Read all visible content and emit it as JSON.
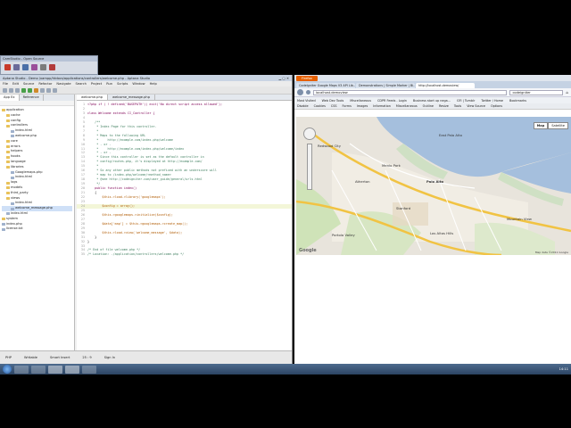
{
  "cam_window": {
    "title": "CamStudio - Open Source"
  },
  "ide": {
    "title": "Aptana Studio - Demo /xampp/htdocs/applications/controllers/welcome.php - Aptana Studio",
    "menu": [
      "File",
      "Edit",
      "Source",
      "Refactor",
      "Navigate",
      "Search",
      "Project",
      "Run",
      "Scripts",
      "Window",
      "Help"
    ],
    "explorer_tabs": [
      "App Ex",
      "Reference"
    ],
    "tree": [
      {
        "label": "application",
        "depth": 0,
        "type": "folder"
      },
      {
        "label": "cache",
        "depth": 1,
        "type": "folder"
      },
      {
        "label": "config",
        "depth": 1,
        "type": "folder"
      },
      {
        "label": "controllers",
        "depth": 1,
        "type": "folder"
      },
      {
        "label": "index.html",
        "depth": 2,
        "type": "file"
      },
      {
        "label": "welcome.php",
        "depth": 2,
        "type": "file"
      },
      {
        "label": "core",
        "depth": 1,
        "type": "folder"
      },
      {
        "label": "errors",
        "depth": 1,
        "type": "folder"
      },
      {
        "label": "helpers",
        "depth": 1,
        "type": "folder"
      },
      {
        "label": "hooks",
        "depth": 1,
        "type": "folder"
      },
      {
        "label": "language",
        "depth": 1,
        "type": "folder"
      },
      {
        "label": "libraries",
        "depth": 1,
        "type": "folder"
      },
      {
        "label": "Googlemaps.php",
        "depth": 2,
        "type": "file"
      },
      {
        "label": "index.html",
        "depth": 2,
        "type": "file"
      },
      {
        "label": "logs",
        "depth": 1,
        "type": "folder"
      },
      {
        "label": "models",
        "depth": 1,
        "type": "folder"
      },
      {
        "label": "third_party",
        "depth": 1,
        "type": "folder"
      },
      {
        "label": "views",
        "depth": 1,
        "type": "folder"
      },
      {
        "label": "index.html",
        "depth": 2,
        "type": "file"
      },
      {
        "label": "welcome_message.php",
        "depth": 2,
        "type": "file",
        "selected": true
      },
      {
        "label": "index.html",
        "depth": 1,
        "type": "file"
      },
      {
        "label": "system",
        "depth": 0,
        "type": "folder"
      },
      {
        "label": "index.php",
        "depth": 0,
        "type": "file"
      },
      {
        "label": "license.txt",
        "depth": 0,
        "type": "file"
      }
    ],
    "editor_tabs": [
      "welcome.php",
      "welcome_message.php"
    ],
    "code": [
      {
        "n": "1",
        "t": "<?php if ( ! defined('BASEPATH')) exit('No direct script access allowed');",
        "cls": "k"
      },
      {
        "n": "2",
        "t": "",
        "cls": ""
      },
      {
        "n": "3",
        "t": "class Welcome extends CI_Controller {",
        "cls": "k"
      },
      {
        "n": "4",
        "t": "",
        "cls": ""
      },
      {
        "n": "5",
        "t": "    /**",
        "cls": "c"
      },
      {
        "n": "6",
        "t": "     * Index Page for this controller.",
        "cls": "c"
      },
      {
        "n": "7",
        "t": "     *",
        "cls": "c"
      },
      {
        "n": "8",
        "t": "     * Maps to the following URL",
        "cls": "c"
      },
      {
        "n": "9",
        "t": "     *     http://example.com/index.php/welcome",
        "cls": "c"
      },
      {
        "n": "10",
        "t": "     * - or -",
        "cls": "c"
      },
      {
        "n": "11",
        "t": "     *     http://example.com/index.php/welcome/index",
        "cls": "c"
      },
      {
        "n": "12",
        "t": "     * - or -",
        "cls": "c"
      },
      {
        "n": "13",
        "t": "     * Since this controller is set as the default controller in",
        "cls": "c"
      },
      {
        "n": "14",
        "t": "     * config/routes.php, it's displayed at http://example.com/",
        "cls": "c"
      },
      {
        "n": "15",
        "t": "     *",
        "cls": "c"
      },
      {
        "n": "16",
        "t": "     * So any other public methods not prefixed with an underscore will",
        "cls": "c"
      },
      {
        "n": "17",
        "t": "     * map to /index.php/welcome/<method_name>",
        "cls": "c"
      },
      {
        "n": "18",
        "t": "     * @see http://codeigniter.com/user_guide/general/urls.html",
        "cls": "c"
      },
      {
        "n": "19",
        "t": "     */",
        "cls": "c"
      },
      {
        "n": "20",
        "t": "    public function index()",
        "cls": "k"
      },
      {
        "n": "21",
        "t": "    {",
        "cls": ""
      },
      {
        "n": "22",
        "t": "        $this->load->library('googlemaps');",
        "cls": "v"
      },
      {
        "n": "23",
        "t": "",
        "cls": ""
      },
      {
        "n": "24",
        "t": "        $config = array();",
        "cls": "v",
        "hl": true
      },
      {
        "n": "25",
        "t": "",
        "cls": ""
      },
      {
        "n": "26",
        "t": "        $this->googlemaps->initialize($config);",
        "cls": "v"
      },
      {
        "n": "27",
        "t": "",
        "cls": ""
      },
      {
        "n": "28",
        "t": "        $data['map'] = $this->googlemaps->create_map();",
        "cls": "v"
      },
      {
        "n": "29",
        "t": "",
        "cls": ""
      },
      {
        "n": "30",
        "t": "        $this->load->view('welcome_message', $data);",
        "cls": "v"
      },
      {
        "n": "31",
        "t": "    }",
        "cls": ""
      },
      {
        "n": "32",
        "t": "}",
        "cls": ""
      },
      {
        "n": "33",
        "t": "",
        "cls": ""
      },
      {
        "n": "34",
        "t": "/* End of file welcome.php */",
        "cls": "c"
      },
      {
        "n": "35",
        "t": "/* Location: ./application/controllers/welcome.php */",
        "cls": "c"
      }
    ],
    "status": [
      "PHP",
      "Writable",
      "Smart Insert",
      "25 : 9",
      "Sign In"
    ]
  },
  "browser": {
    "app_button": "Firefox",
    "tabs": [
      {
        "label": "CodeIgniter Google Maps V3 API Lib...",
        "active": false
      },
      {
        "label": "Demonstrations | Simple Marker | Bi...",
        "active": false
      },
      {
        "label": "http://localhost.demoview/",
        "active": true
      }
    ],
    "url": "localhost.demoview",
    "search": "codeigniter",
    "bookmarks": [
      "Most Visited",
      "Web Dev Tools",
      "Miscellaneous",
      "CDPR Feeds - Login",
      "Business start up nega...",
      "GFI | Tumblr",
      "Twitter / Home",
      "Bookmarks"
    ],
    "toolbar2": [
      "Disable",
      "Cookies",
      "CSS",
      "Forms",
      "Images",
      "Information",
      "Miscellaneous",
      "Outline",
      "Resize",
      "Tools",
      "View Source",
      "Options"
    ],
    "map": {
      "types": [
        "Map",
        "Satellite"
      ],
      "places": [
        "East Palo Alto",
        "Palo Alto",
        "Menlo Park",
        "Atherton",
        "Stanford",
        "Los Altos Hills",
        "Portola Valley",
        "Redwood City",
        "Mountain View"
      ],
      "logo": "Google",
      "attribution": "Map data ©2011 Google"
    }
  },
  "taskbar": {
    "clock": "14:11"
  }
}
